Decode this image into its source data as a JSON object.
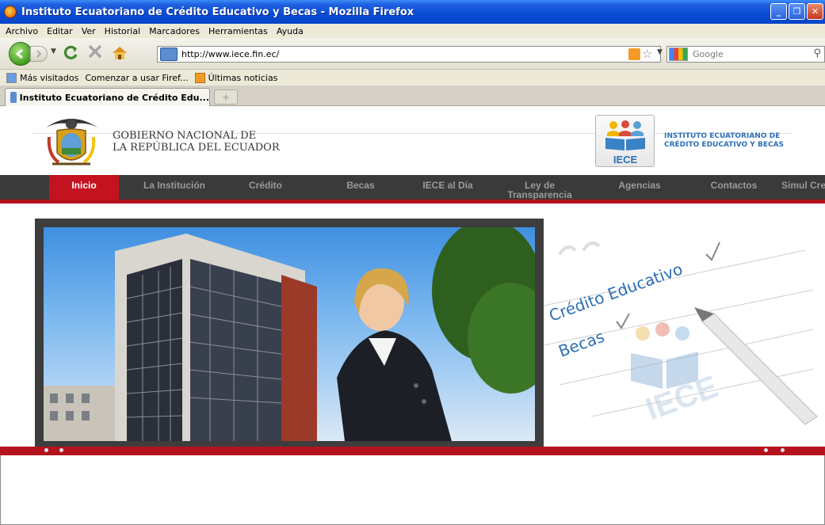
{
  "window": {
    "title": "Instituto Ecuatoriano de Crédito Educativo y Becas - Mozilla Firefox",
    "minimize": "_",
    "restore": "❐",
    "close": "✕"
  },
  "menu": [
    "Archivo",
    "Editar",
    "Ver",
    "Historial",
    "Marcadores",
    "Herramientas",
    "Ayuda"
  ],
  "toolbar": {
    "url": "http://www.iece.fin.ec/",
    "search_placeholder": "Google"
  },
  "bookmarks": [
    "Más visitados",
    "Comenzar a usar Firef...",
    "Últimas noticias"
  ],
  "tab": {
    "label": "Instituto Ecuatoriano de Crédito Edu...",
    "new_tab": "+"
  },
  "page": {
    "gov_line1": "GOBIERNO NACIONAL DE",
    "gov_line2": "LA REPÚBLICA DEL ECUADOR",
    "logo_text": "IECE",
    "inst_line1": "INSTITUTO ECUATORIANO DE",
    "inst_line2": "CRÉDITO EDUCATIVO Y BECAS",
    "nav": [
      {
        "label": "Inicio"
      },
      {
        "label": "La Institución"
      },
      {
        "label": "Crédito"
      },
      {
        "label": "Becas"
      },
      {
        "label": "IECE al Día"
      },
      {
        "label": "Ley de Transparencia"
      },
      {
        "label": "Agencias"
      },
      {
        "label": "Contactos"
      },
      {
        "label": "Simul Cre"
      }
    ],
    "side_text_1": "Crédito Educativo",
    "side_text_2": "Becas",
    "side_logo": "IECE"
  },
  "colors": {
    "accent_red": "#c4121f",
    "nav_bg": "#3a3a3a",
    "inst_blue": "#2d6fb5"
  }
}
